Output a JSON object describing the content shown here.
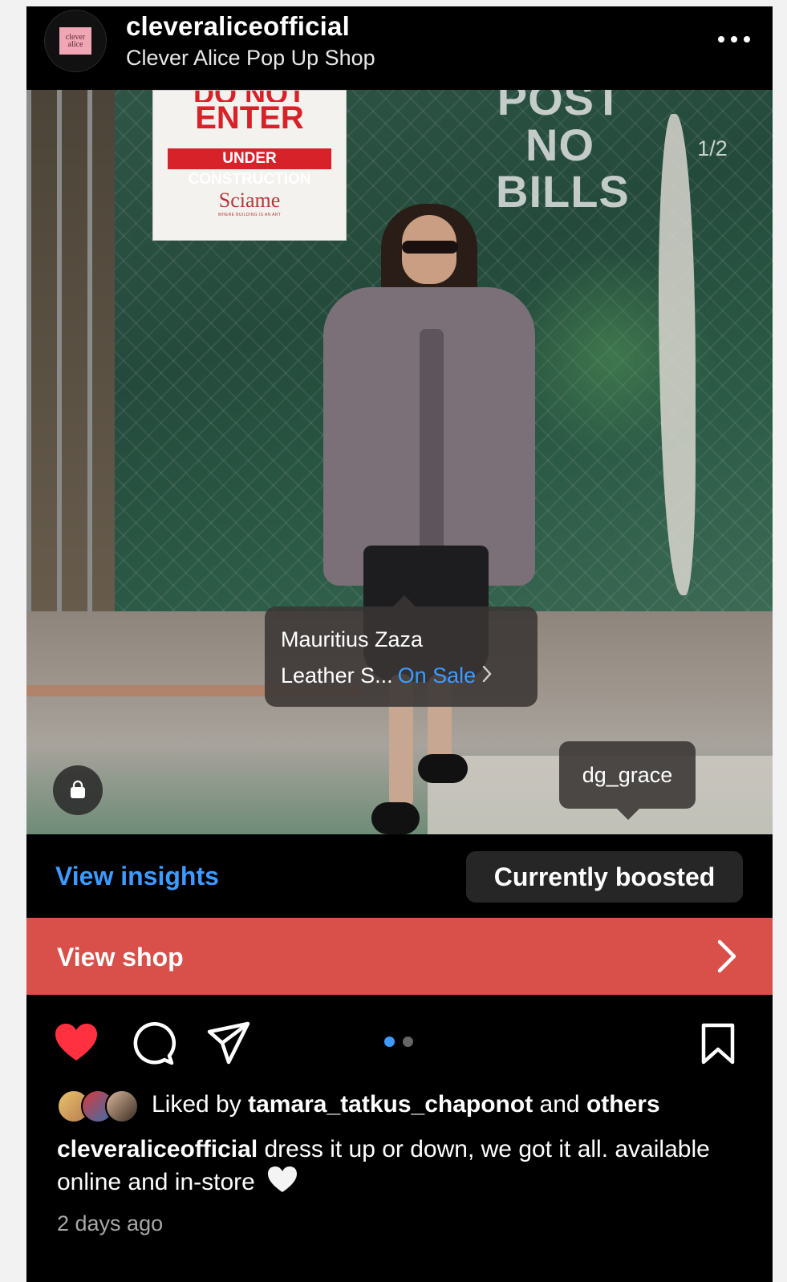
{
  "header": {
    "avatar_text": "clever alice",
    "username": "cleveraliceofficial",
    "location": "Clever Alice Pop Up Shop"
  },
  "photo": {
    "counter": "1/2",
    "sign": {
      "line_top": "DO NOT",
      "line_main": "ENTER",
      "band": "UNDER CONSTRUCTION",
      "brand": "Sciame",
      "tagline": "WHERE BUILDING IS AN ART"
    },
    "stencil": [
      "POST",
      "NO",
      "BILLS"
    ],
    "product_tag": {
      "line1": "Mauritius Zaza",
      "line2": "Leather S...",
      "status": "On Sale"
    },
    "user_tag": "dg_grace"
  },
  "insights": {
    "view_label": "View insights",
    "boost_label": "Currently boosted"
  },
  "shop": {
    "label": "View shop"
  },
  "actions": {
    "liked": true,
    "carousel_count": 2,
    "carousel_active": 0
  },
  "likes": {
    "prefix": "Liked by",
    "user": "tamara_tatkus_chaponot",
    "joiner": "and",
    "others": "others"
  },
  "caption": {
    "username": "cleveraliceofficial",
    "text": "dress it up or down, we got it all. available online and in-store"
  },
  "timestamp": "2 days ago",
  "colors": {
    "accent_blue": "#3d9bff",
    "like_red": "#ff3040",
    "shop_bar": "#d94f4a",
    "boost_bg": "#262626"
  },
  "icons": [
    "more-icon",
    "shopping-bag-icon",
    "heart-icon",
    "comment-icon",
    "share-icon",
    "bookmark-icon",
    "chevron-right-icon",
    "white-heart-emoji"
  ]
}
